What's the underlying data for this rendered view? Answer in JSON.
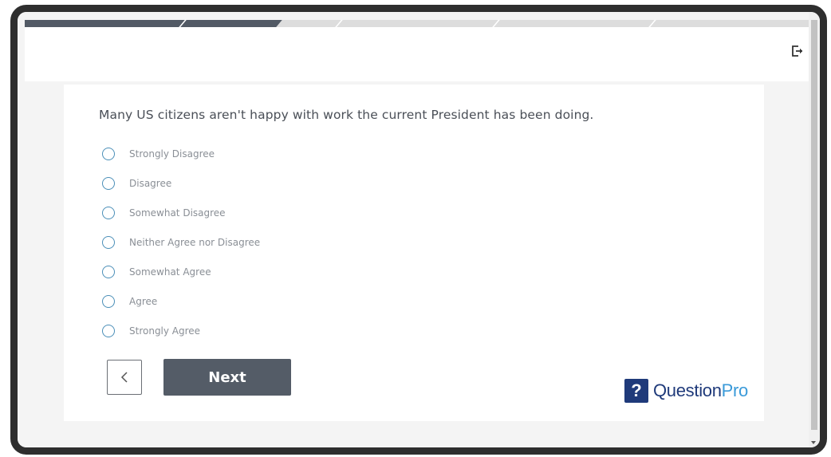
{
  "progress": {
    "percent": 32,
    "segments": 5
  },
  "header": {
    "exit_icon": "exit-icon"
  },
  "question": {
    "text": "Many US citizens aren't happy with work the current President has been doing.",
    "options": [
      {
        "label": "Strongly Disagree",
        "selected": false
      },
      {
        "label": "Disagree",
        "selected": false
      },
      {
        "label": "Somewhat Disagree",
        "selected": false
      },
      {
        "label": "Neither Agree nor Disagree",
        "selected": false
      },
      {
        "label": "Somewhat Agree",
        "selected": false
      },
      {
        "label": "Agree",
        "selected": false
      },
      {
        "label": "Strongly Agree",
        "selected": false
      }
    ]
  },
  "navigation": {
    "back_icon": "chevron-left-icon",
    "next_label": "Next"
  },
  "branding": {
    "logo_mark": "?",
    "logo_text_part1": "Question",
    "logo_text_part2": "Pro",
    "primary_color": "#1f3a7a",
    "accent_color": "#3a9ad9"
  },
  "colors": {
    "progress_fill": "#525a65",
    "progress_track": "#dddddd",
    "radio_border": "#4b8fb8",
    "next_button": "#545c67"
  }
}
